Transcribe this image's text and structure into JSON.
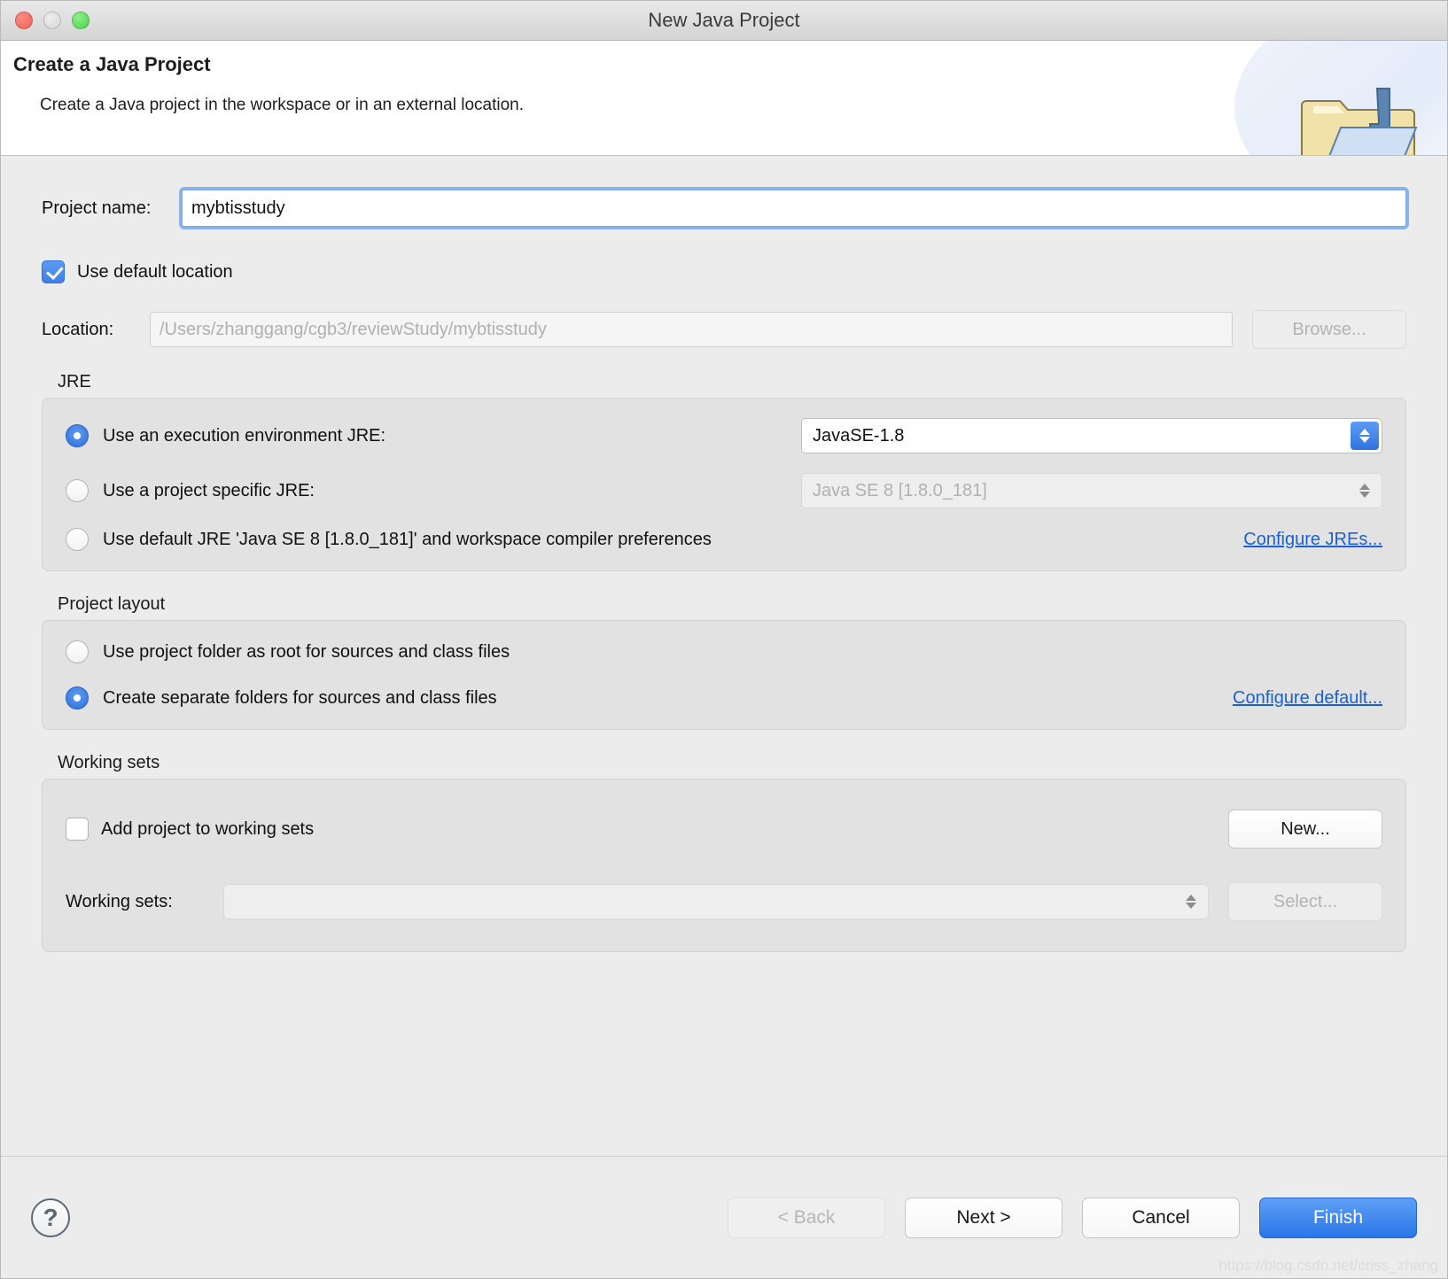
{
  "window": {
    "title": "New Java Project",
    "traffic_lights": [
      "close-button",
      "minimize-button",
      "zoom-button"
    ]
  },
  "header": {
    "title": "Create a Java Project",
    "description": "Create a Java project in the workspace or in an external location.",
    "icon": "java-project-folder-icon"
  },
  "project_name": {
    "label": "Project name:",
    "value": "mybtisstudy",
    "placeholder": ""
  },
  "use_default_location": {
    "label": "Use default location",
    "checked": true
  },
  "location": {
    "label": "Location:",
    "value": "/Users/zhanggang/cgb3/reviewStudy/mybtisstudy",
    "browse_label": "Browse...",
    "browse_enabled": false,
    "input_enabled": false
  },
  "jre": {
    "group_title": "JRE",
    "options": [
      {
        "label": "Use an execution environment JRE:",
        "selected": true
      },
      {
        "label": "Use a project specific JRE:",
        "selected": false
      },
      {
        "label": "Use default JRE 'Java SE 8 [1.8.0_181]' and workspace compiler preferences",
        "selected": false
      }
    ],
    "execution_environment_value": "JavaSE-1.8",
    "project_specific_value": "Java SE 8 [1.8.0_181]",
    "configure_link": "Configure JREs..."
  },
  "project_layout": {
    "group_title": "Project layout",
    "options": [
      {
        "label": "Use project folder as root for sources and class files",
        "selected": false
      },
      {
        "label": "Create separate folders for sources and class files",
        "selected": true
      }
    ],
    "configure_link": "Configure default..."
  },
  "working_sets": {
    "group_title": "Working sets",
    "add_checkbox_label": "Add project to working sets",
    "add_checked": false,
    "new_button": "New...",
    "combo_label": "Working sets:",
    "combo_value": "",
    "select_button": "Select...",
    "select_enabled": false
  },
  "footer": {
    "help_glyph": "?",
    "buttons": [
      {
        "label": "< Back",
        "state": "disabled"
      },
      {
        "label": "Next >",
        "state": "normal"
      },
      {
        "label": "Cancel",
        "state": "normal"
      },
      {
        "label": "Finish",
        "state": "primary"
      }
    ]
  },
  "watermark": "https://blog.csdn.net/criss_zhang",
  "colors": {
    "accent_blue": "#2f73e0",
    "link_blue": "#1b60d4",
    "window_bg": "#ececec",
    "group_bg": "#e2e2e2"
  }
}
